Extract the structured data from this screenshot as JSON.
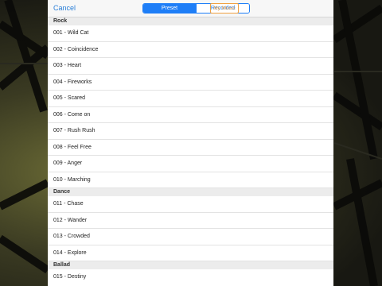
{
  "nav": {
    "cancel_label": "Cancel",
    "segments": [
      "Preset",
      "Recorded"
    ],
    "my_music_label": "My Music"
  },
  "sections": [
    {
      "header": "Rock",
      "items": [
        "001 - Wild Cat",
        "002 - Coincidence",
        "003 - Heart",
        "004 - Fireworks",
        "005 - Scared",
        "006 - Come on",
        "007 - Rush Rush",
        "008 - Feel Free",
        "009 - Anger",
        "010 - Marching"
      ]
    },
    {
      "header": "Dance",
      "items": [
        "011 - Chase",
        "012 - Wander",
        "013 - Crowded",
        "014 - Explore"
      ]
    },
    {
      "header": "Ballad",
      "items": [
        "015 - Destiny"
      ]
    }
  ],
  "colors": {
    "accent": "#1e7ef7",
    "my_music": "#f0a040"
  }
}
